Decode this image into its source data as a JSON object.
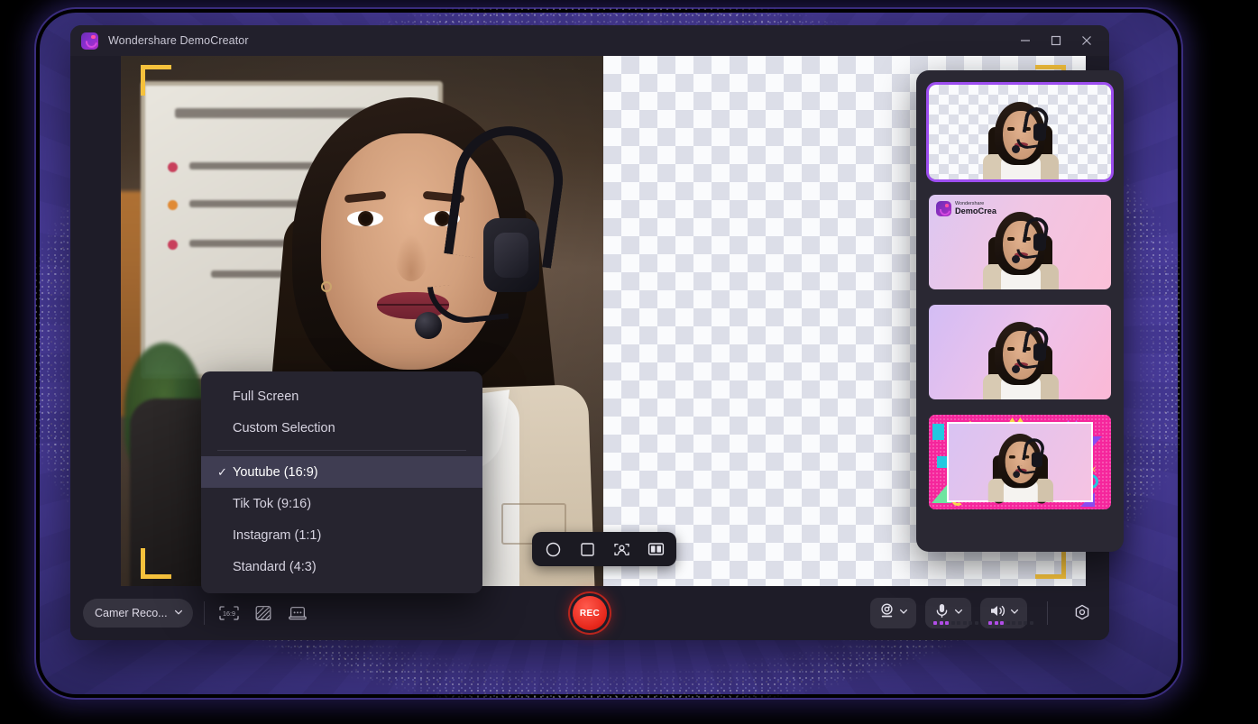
{
  "window": {
    "title": "Wondershare DemoCreator",
    "logo_icon": "democreator-logo-icon",
    "controls": {
      "minimize": "minimize-icon",
      "maximize": "maximize-icon",
      "close": "close-icon"
    }
  },
  "preview": {
    "crop_markers": [
      "top-left",
      "top-right",
      "bottom-left",
      "bottom-right"
    ],
    "crop_marker_color": "#f5c13c",
    "transparent_background": true,
    "float_toolbar": [
      {
        "name": "circle-mask-button",
        "icon": "circle-icon"
      },
      {
        "name": "square-mask-button",
        "icon": "square-icon"
      },
      {
        "name": "face-detect-button",
        "icon": "face-focus-icon"
      },
      {
        "name": "split-view-button",
        "icon": "split-view-icon"
      }
    ]
  },
  "menu": {
    "items": [
      {
        "label": "Full Screen",
        "selected": false,
        "separator_after": true
      },
      {
        "label": "Custom Selection",
        "selected": false,
        "separator_after": true
      },
      {
        "label": "Youtube (16:9)",
        "selected": true,
        "separator_after": false
      },
      {
        "label": "Tik Tok (9:16)",
        "selected": false,
        "separator_after": false
      },
      {
        "label": "Instagram (1:1)",
        "selected": false,
        "separator_after": false
      },
      {
        "label": "Standard (4:3)",
        "selected": false,
        "separator_after": false
      }
    ],
    "check_glyph": "✓",
    "highlight_color": "#3f3d52"
  },
  "toolbar": {
    "source_select": {
      "label": "Camer Reco...",
      "icon": "chevron-down-icon"
    },
    "tools": [
      {
        "name": "aspect-ratio-button",
        "label": "16:9",
        "icon": "aspect-ratio-icon"
      },
      {
        "name": "background-blur-button",
        "icon": "hatch-pattern-icon"
      },
      {
        "name": "teleprompter-button",
        "icon": "teleprompter-icon"
      }
    ],
    "record": {
      "label": "REC",
      "name": "record-button",
      "color": "#e8291d"
    },
    "devices": [
      {
        "name": "webcam-device",
        "icon": "webcam-icon",
        "levels_on": 0,
        "levels_total": 0,
        "has_levels": false
      },
      {
        "name": "microphone-device",
        "icon": "microphone-icon",
        "levels_on": 3,
        "levels_total": 8,
        "has_levels": true
      },
      {
        "name": "speaker-device",
        "icon": "speaker-icon",
        "levels_on": 3,
        "levels_total": 8,
        "has_levels": true
      }
    ],
    "settings": {
      "name": "settings-button",
      "icon": "gear-hex-icon"
    },
    "level_on_color": "#b24de8"
  },
  "thumbnails": {
    "items": [
      {
        "name": "thumbnail-transparent",
        "style": "checkerboard",
        "active": true,
        "brand": null
      },
      {
        "name": "thumbnail-branded-gradient",
        "style": "gradient-pink",
        "active": false,
        "brand": {
          "line1": "Wondershare",
          "line2": "DemoCrea"
        }
      },
      {
        "name": "thumbnail-gradient",
        "style": "gradient-purple",
        "active": false,
        "brand": null
      },
      {
        "name": "thumbnail-memphis-frame",
        "style": "pink-frame",
        "active": false,
        "brand": null
      }
    ],
    "active_border_color": "#9d4ef0"
  },
  "colors": {
    "backdrop": "#4a3c9d",
    "window_bg": "#1e1c28",
    "panel_bg": "#2a2833",
    "menu_bg": "#26242f"
  }
}
